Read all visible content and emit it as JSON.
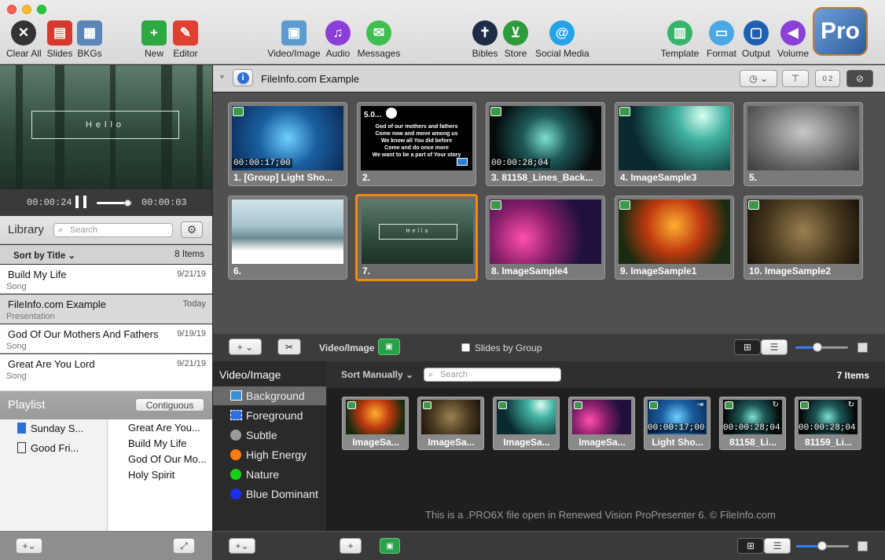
{
  "toolbar": {
    "clear_all": "Clear All",
    "slides": "Slides",
    "bkgs": "BKGs",
    "new": "New",
    "editor": "Editor",
    "video_image": "Video/Image",
    "audio": "Audio",
    "messages": "Messages",
    "bibles": "Bibles",
    "store": "Store",
    "social_media": "Social Media",
    "template": "Template",
    "format": "Format",
    "output": "Output",
    "volume": "Volume",
    "logo": "Pro"
  },
  "preview": {
    "text": "Hello",
    "elapsed": "00:00:24",
    "remaining": "00:00:03",
    "progress": 0.88
  },
  "library": {
    "title": "Library",
    "search_placeholder": "Search",
    "sort_label": "Sort by Title",
    "count": "8 Items",
    "items": [
      {
        "title": "Build My Life",
        "date": "9/21/19",
        "kind": "Song"
      },
      {
        "title": "FileInfo.com Example",
        "date": "Today",
        "kind": "Presentation"
      },
      {
        "title": "God Of Our Mothers And Fathers",
        "date": "9/19/19",
        "kind": "Song"
      },
      {
        "title": "Great Are You Lord",
        "date": "9/21/19",
        "kind": "Song"
      }
    ]
  },
  "playlist": {
    "title": "Playlist",
    "mode": "Contiguous",
    "folders": [
      {
        "label": "Sunday S..."
      },
      {
        "label": "Good Fri..."
      }
    ],
    "items": [
      "Great Are You...",
      "Build My Life",
      "God Of Our Mo...",
      "Holy Spirit"
    ]
  },
  "document": {
    "title": "FileInfo.com Example",
    "counter_icon": "0 2"
  },
  "slides": [
    {
      "label": "1. [Group] Light Sho...",
      "time": "00:00:17;00"
    },
    {
      "label": "2.",
      "time": "5.0...",
      "lyrics": [
        "God of our mothers and fathers",
        "Come now and move among us",
        "We know all You did before",
        "Come and do once more",
        "We want to be a part of Your story"
      ]
    },
    {
      "label": "3. 81158_Lines_Back...",
      "time": "00:00:28;04"
    },
    {
      "label": "4. ImageSample3"
    },
    {
      "label": "5."
    },
    {
      "label": "6."
    },
    {
      "label": "7.",
      "text": "Hello"
    },
    {
      "label": "8. ImageSample4"
    },
    {
      "label": "9. ImageSample1"
    },
    {
      "label": "10. ImageSample2"
    }
  ],
  "slides_toolbar": {
    "video_image_label": "Video/Image",
    "slides_by_group": "Slides by Group"
  },
  "media": {
    "sidebar_title": "Video/Image",
    "categories": [
      {
        "label": "Background",
        "color": "#3b8fd6"
      },
      {
        "label": "Foreground",
        "color": "#2f6fe0"
      },
      {
        "label": "Subtle",
        "color": "#9a9a9a"
      },
      {
        "label": "High Energy",
        "color": "#ff7a10"
      },
      {
        "label": "Nature",
        "color": "#16d016"
      },
      {
        "label": "Blue Dominant",
        "color": "#1a2ef0"
      }
    ],
    "sort_label": "Sort Manually",
    "search_placeholder": "Search",
    "count": "7 Items",
    "thumbs": [
      {
        "label": "ImageSa..."
      },
      {
        "label": "ImageSa..."
      },
      {
        "label": "ImageSa..."
      },
      {
        "label": "ImageSa..."
      },
      {
        "label": "Light Sho...",
        "time": "00:00:17;00"
      },
      {
        "label": "81158_Li...",
        "time": "00:00:28;04"
      },
      {
        "label": "81159_Li...",
        "time": "00:00:28;04"
      }
    ],
    "watermark": "This is a .PRO6X file open in Renewed Vision ProPresenter 6. © FileInfo.com"
  }
}
